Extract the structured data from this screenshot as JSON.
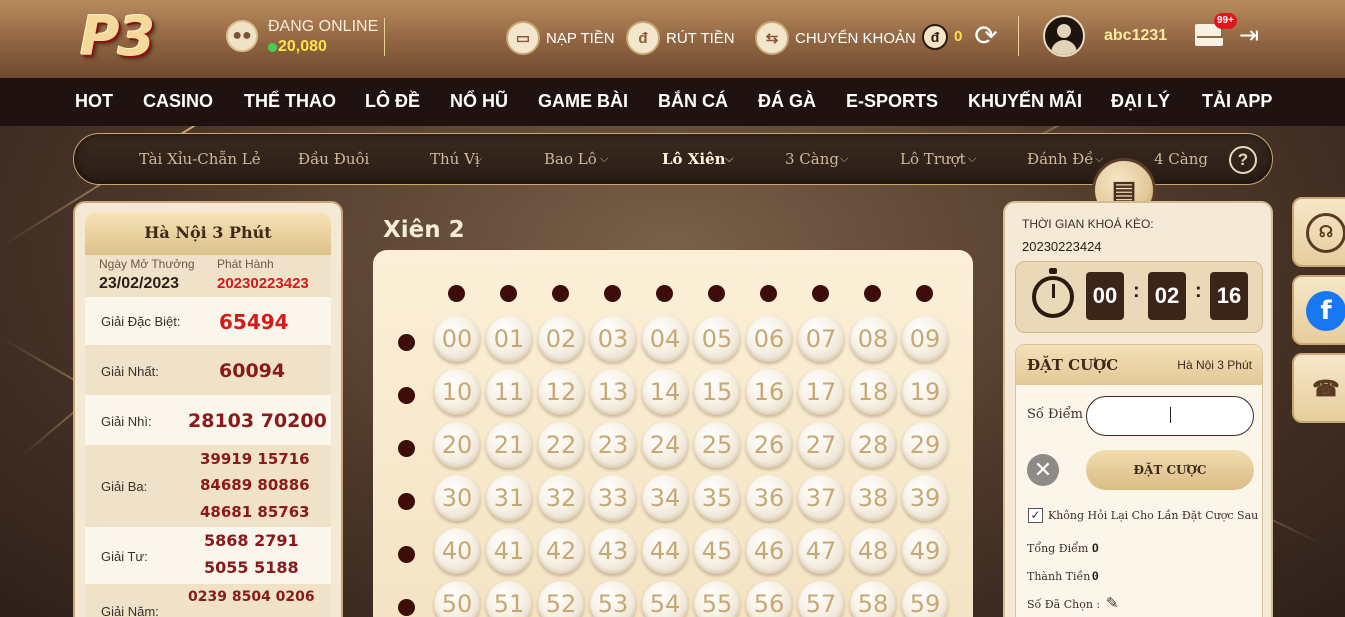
{
  "header": {
    "logo": "P3",
    "online": {
      "label": "ĐANG ONLINE",
      "count": "20,080"
    },
    "actions": {
      "deposit": "NẠP TIỀN",
      "withdraw": "RÚT TIỀN",
      "transfer": "CHUYỂN KHOẢN"
    },
    "coin_icon": "đ",
    "balance": "0",
    "username": "abc1231",
    "mail_badge": "99+"
  },
  "nav": [
    "HOT",
    "CASINO",
    "THỂ THAO",
    "LÔ ĐỀ",
    "NỔ HŨ",
    "GAME BÀI",
    "BẮN CÁ",
    "ĐÁ GÀ",
    "E-SPORTS",
    "KHUYẾN MÃI",
    "ĐẠI LÝ",
    "TẢI APP"
  ],
  "subnav": {
    "items": [
      "Tài Xỉu-Chẵn Lẻ",
      "Đầu Đuôi",
      "Thú Vị",
      "Bao Lô",
      "Lô Xiên",
      "3 Càng",
      "Lô Trượt",
      "Đánh Đề",
      "4 Càng"
    ],
    "active_index": 4,
    "help": "?"
  },
  "results": {
    "title": "Hà Nội 3 Phút",
    "draw_date_label": "Ngày Mở Thưởng",
    "draw_date": "23/02/2023",
    "issue_label": "Phát Hành",
    "issue": "20230223423",
    "prizes": [
      {
        "label": "Giải Đặc Biệt:",
        "values": [
          "65494"
        ]
      },
      {
        "label": "Giải Nhất:",
        "values": [
          "60094"
        ]
      },
      {
        "label": "Giải Nhì:",
        "values": [
          "28103 70200"
        ]
      },
      {
        "label": "Giải Ba:",
        "values": [
          "39919 15716",
          "84689 80886",
          "48681 85763"
        ]
      },
      {
        "label": "Giải Tư:",
        "values": [
          "5868 2791",
          "5055 5188"
        ]
      },
      {
        "label": "Giải Năm:",
        "values": [
          "0239 8504 0206"
        ]
      }
    ]
  },
  "grid": {
    "title": "Xiên 2",
    "numbers": [
      [
        "00",
        "01",
        "02",
        "03",
        "04",
        "05",
        "06",
        "07",
        "08",
        "09"
      ],
      [
        "10",
        "11",
        "12",
        "13",
        "14",
        "15",
        "16",
        "17",
        "18",
        "19"
      ],
      [
        "20",
        "21",
        "22",
        "23",
        "24",
        "25",
        "26",
        "27",
        "28",
        "29"
      ],
      [
        "30",
        "31",
        "32",
        "33",
        "34",
        "35",
        "36",
        "37",
        "38",
        "39"
      ],
      [
        "40",
        "41",
        "42",
        "43",
        "44",
        "45",
        "46",
        "47",
        "48",
        "49"
      ],
      [
        "50",
        "51",
        "52",
        "53",
        "54",
        "55",
        "56",
        "57",
        "58",
        "59"
      ]
    ]
  },
  "bet": {
    "lock_label": "THỜI GIAN KHOÁ KÈO:",
    "lock_id": "20230223424",
    "timer": {
      "h": "00",
      "m": "02",
      "s": "16"
    },
    "title": "ĐẶT CƯỢC",
    "region": "Hà Nội 3 Phút",
    "points_label": "Số Điểm",
    "points_value": "",
    "clear": "✕",
    "place_label": "ĐẶT CƯỢC",
    "no_ask_label": "Không Hỏi Lại Cho Lần Đặt Cược Sau",
    "no_ask_checked": true,
    "total_points_label": "Tổng Điểm :",
    "total_points": "0",
    "amount_label": "Thành Tiền :",
    "amount": "0",
    "selected_label": "Số Đã Chọn :"
  },
  "colors": {
    "accent": "#c9a672",
    "topbar": "#8f6440",
    "navbar": "#1f1210",
    "prize": "#8a1a1a",
    "special": "#d41a1a"
  },
  "side_buttons": [
    "support-headset-icon",
    "facebook-icon",
    "phone-icon"
  ]
}
